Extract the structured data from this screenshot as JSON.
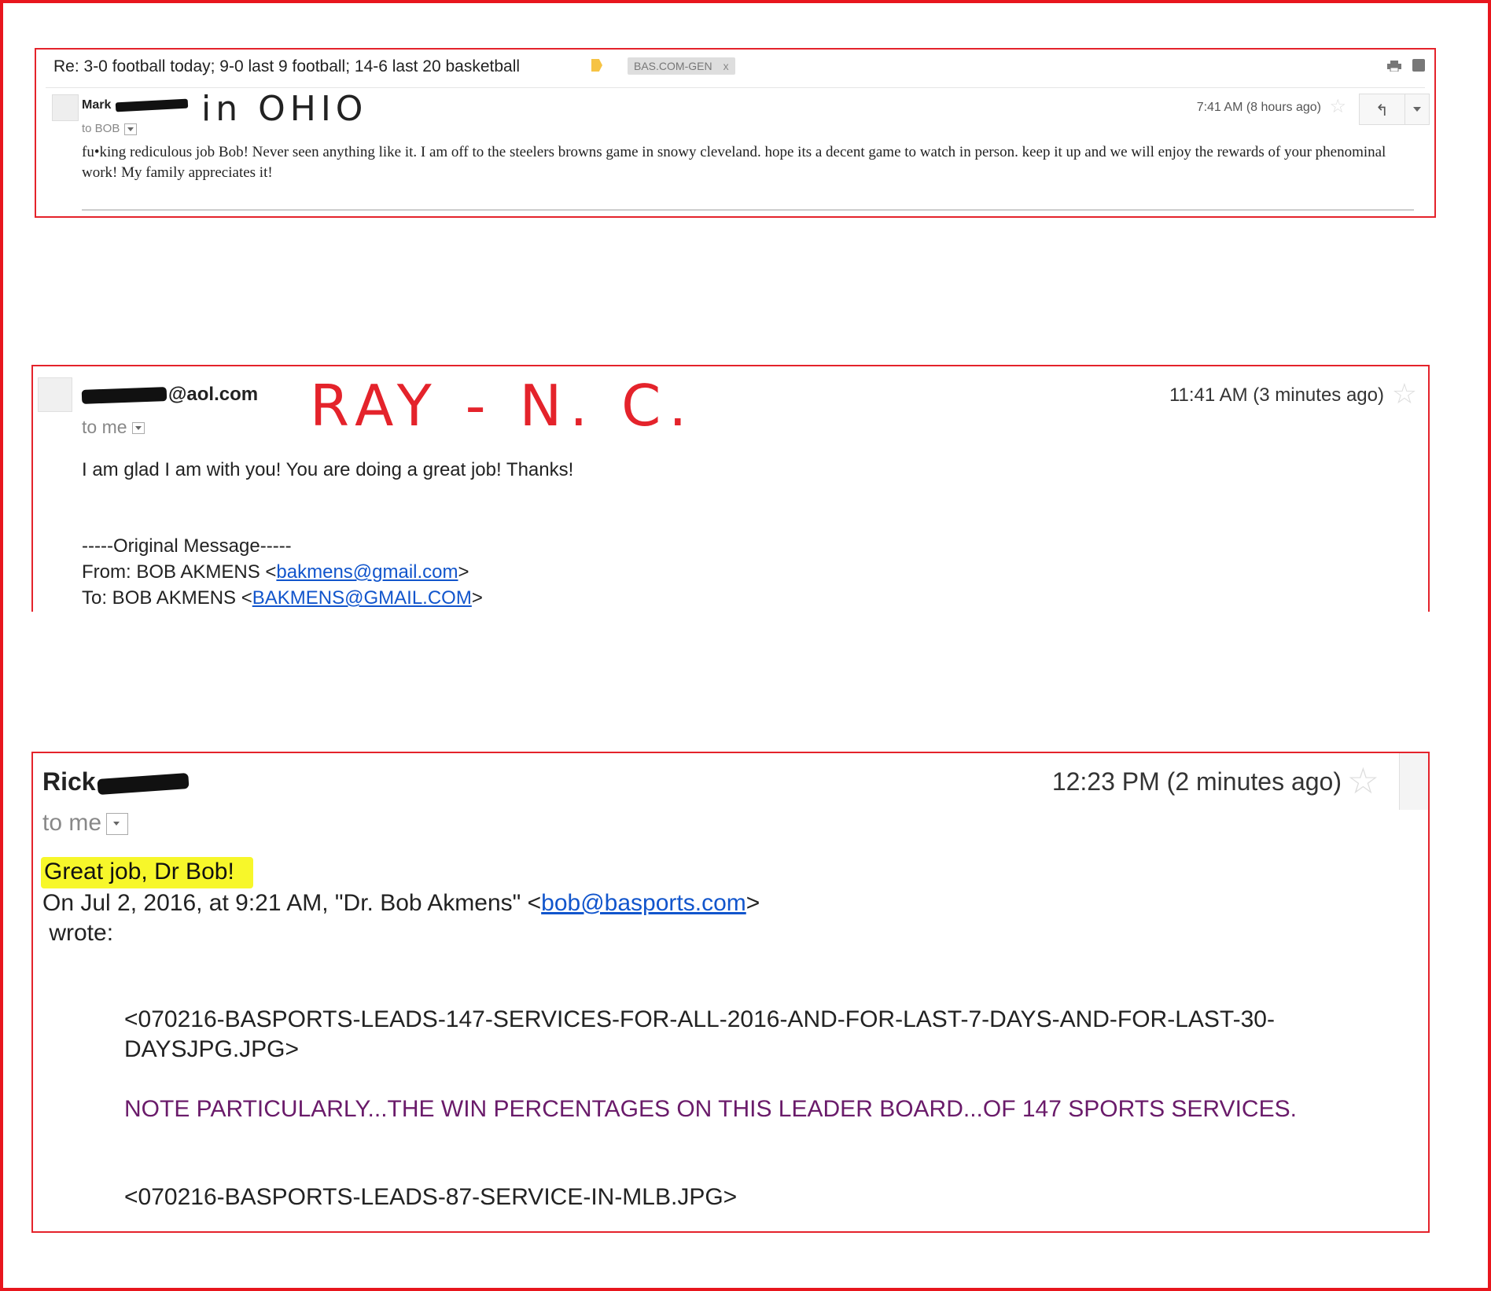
{
  "email1": {
    "subject": "Re: 3-0 football today; 9-0 last 9 football; 14-6 last 20 basketball",
    "label_chip": "BAS.COM-GEN",
    "label_chip_close": "x",
    "sender_first": "Mark",
    "handwritten_note": "in OHIO",
    "to": "to BOB",
    "time": "7:41 AM (8 hours ago)",
    "body": "fu•king rediculous job Bob!  Never seen anything like it.  I am off to the steelers browns game in snowy cleveland.  hope its a decent game to watch in person.  keep it up and we will enjoy the rewards of your phenominal work!  My family appreciates it!"
  },
  "email2": {
    "sender_domain": "@aol.com",
    "handwritten_note": "RAY - N. C.",
    "to": "to me",
    "time": "11:41 AM (3 minutes ago)",
    "body": "I am glad I  am with you! You are doing a great job! Thanks!",
    "orig_header": "-----Original Message-----",
    "from_prefix": "From: BOB AKMENS <",
    "from_email": "bakmens@gmail.com",
    "to_prefix": "To: BOB AKMENS <",
    "to_email": "BAKMENS@GMAIL.COM",
    "close_bracket": ">"
  },
  "email3": {
    "sender_first": "Rick",
    "to": "to me",
    "time": "12:23 PM (2 minutes ago)",
    "highlight": "Great job, Dr Bob!",
    "quote_prefix": "On Jul 2, 2016, at 9:21 AM, \"Dr. Bob Akmens\" <",
    "quote_email": "bob@basports.com",
    "quote_suffix": ">",
    "wrote": " wrote:",
    "attachment1": "<070216-BASPORTS-LEADS-147-SERVICES-FOR-ALL-2016-AND-FOR-LAST-7-DAYS-AND-FOR-LAST-30-DAYSJPG.JPG>",
    "note": "NOTE PARTICULARLY...THE WIN PERCENTAGES ON THIS LEADER BOARD...OF 147 SPORTS SERVICES.",
    "attachment2": "<070216-BASPORTS-LEADS-87-SERVICE-IN-MLB.JPG>"
  },
  "icons": {
    "star": "☆",
    "reply": "↰"
  },
  "colors": {
    "frame": "#e8161d",
    "highlight": "#f7f72a",
    "link": "#1155cc",
    "note": "#6a1b6a"
  }
}
